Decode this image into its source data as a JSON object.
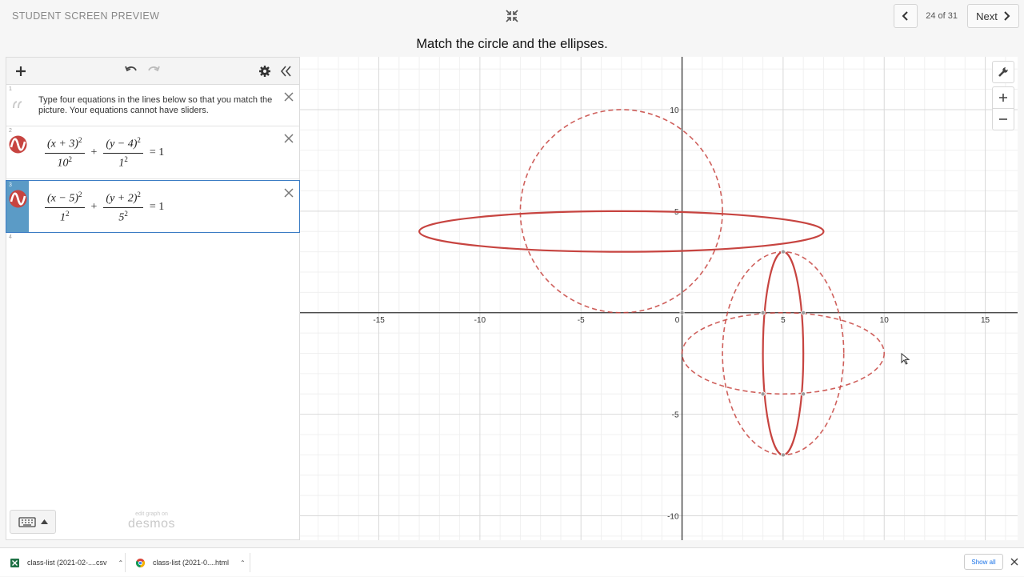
{
  "header": {
    "preview_label": "STUDENT SCREEN PREVIEW",
    "page_counter": "24 of 31",
    "next_label": "Next",
    "prompt": "Match the circle and the ellipses."
  },
  "expressions": [
    {
      "index": "1",
      "type": "note",
      "text": "Type four equations in the lines below so that you match the  picture. Your equations cannot have sliders."
    },
    {
      "index": "2",
      "type": "equation",
      "num1": "(x + 3)",
      "den1": "10",
      "num2": "(y − 4)",
      "den2": "1",
      "exp": "2",
      "plus": "+",
      "rhs": "= 1",
      "color": "#c74440"
    },
    {
      "index": "3",
      "type": "equation",
      "num1": "(x − 5)",
      "den1": "1",
      "num2": "(y + 2)",
      "den2": "5",
      "exp": "2",
      "plus": "+",
      "rhs": "= 1",
      "color": "#c74440"
    },
    {
      "index": "4",
      "type": "empty"
    }
  ],
  "panel": {
    "logo_small": "edit graph on",
    "logo_big": "desmos"
  },
  "graph": {
    "xlim": [
      -18.9,
      16.6
    ],
    "ylim": [
      -11.2,
      12.6
    ],
    "x_ticks": [
      -15,
      -10,
      -5,
      0,
      5,
      10,
      15
    ],
    "y_ticks": [
      -10,
      -5,
      5,
      10
    ],
    "minor_step": 1,
    "major_step": 5,
    "curve_color": "#c74440",
    "curves": [
      {
        "cx": -3,
        "cy": 4,
        "rx": 10,
        "ry": 1,
        "style": "solid"
      },
      {
        "cx": 5,
        "cy": -2,
        "rx": 1,
        "ry": 5,
        "style": "solid"
      },
      {
        "cx": -3,
        "cy": 5,
        "rx": 5,
        "ry": 5,
        "style": "dashed"
      },
      {
        "cx": 5,
        "cy": -2,
        "rx": 3,
        "ry": 5,
        "style": "dashed"
      },
      {
        "cx": 5,
        "cy": -2,
        "rx": 5,
        "ry": 2,
        "style": "dashed"
      }
    ],
    "points": [
      [
        5,
        3
      ],
      [
        5,
        -7
      ],
      [
        4,
        0
      ],
      [
        6,
        0
      ],
      [
        4,
        -4
      ],
      [
        6,
        -4
      ],
      [
        0,
        0
      ]
    ]
  },
  "downloads": [
    {
      "name": "class-list (2021-02-....csv",
      "icon": "excel-file-icon"
    },
    {
      "name": "class-list (2021-0....html",
      "icon": "chrome-file-icon"
    }
  ],
  "bottombar": {
    "show_all": "Show all"
  }
}
